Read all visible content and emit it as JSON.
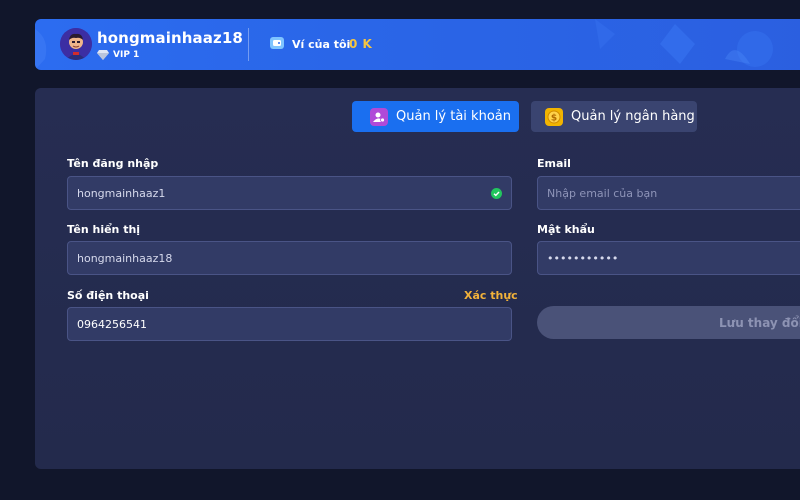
{
  "user": {
    "username": "hongmainhaaz18",
    "vip_level": "VIP 1"
  },
  "wallet": {
    "label": "Ví của tôi",
    "amount": "0 K"
  },
  "tabs": [
    {
      "label": "Quản lý tài khoản",
      "icon": "user-settings-icon",
      "active": true
    },
    {
      "label": "Quản lý ngân hàng",
      "icon": "coin-icon",
      "active": false
    }
  ],
  "form": {
    "login_name": {
      "label": "Tên đăng nhập",
      "value": "hongmainhaaz1"
    },
    "display_name": {
      "label": "Tên hiển thị",
      "value": "hongmainhaaz18"
    },
    "phone": {
      "label": "Số điện thoại",
      "value": "0964256541",
      "verify_label": "Xác thực"
    },
    "email": {
      "label": "Email",
      "placeholder": "Nhập email của bạn",
      "value": ""
    },
    "password": {
      "label": "Mật khẩu",
      "value": "•••••••••••"
    },
    "save_label": "Lưu thay đổi"
  },
  "colors": {
    "background": "#11162b",
    "header": "#2c6cf0",
    "panel": "#262d52",
    "active_tab": "#1a6ff0",
    "inactive_tab": "#3a4470",
    "field": "#323b66",
    "accent_gold": "#f5c542",
    "verify": "#f2b23a",
    "check_green": "#22c55e"
  }
}
